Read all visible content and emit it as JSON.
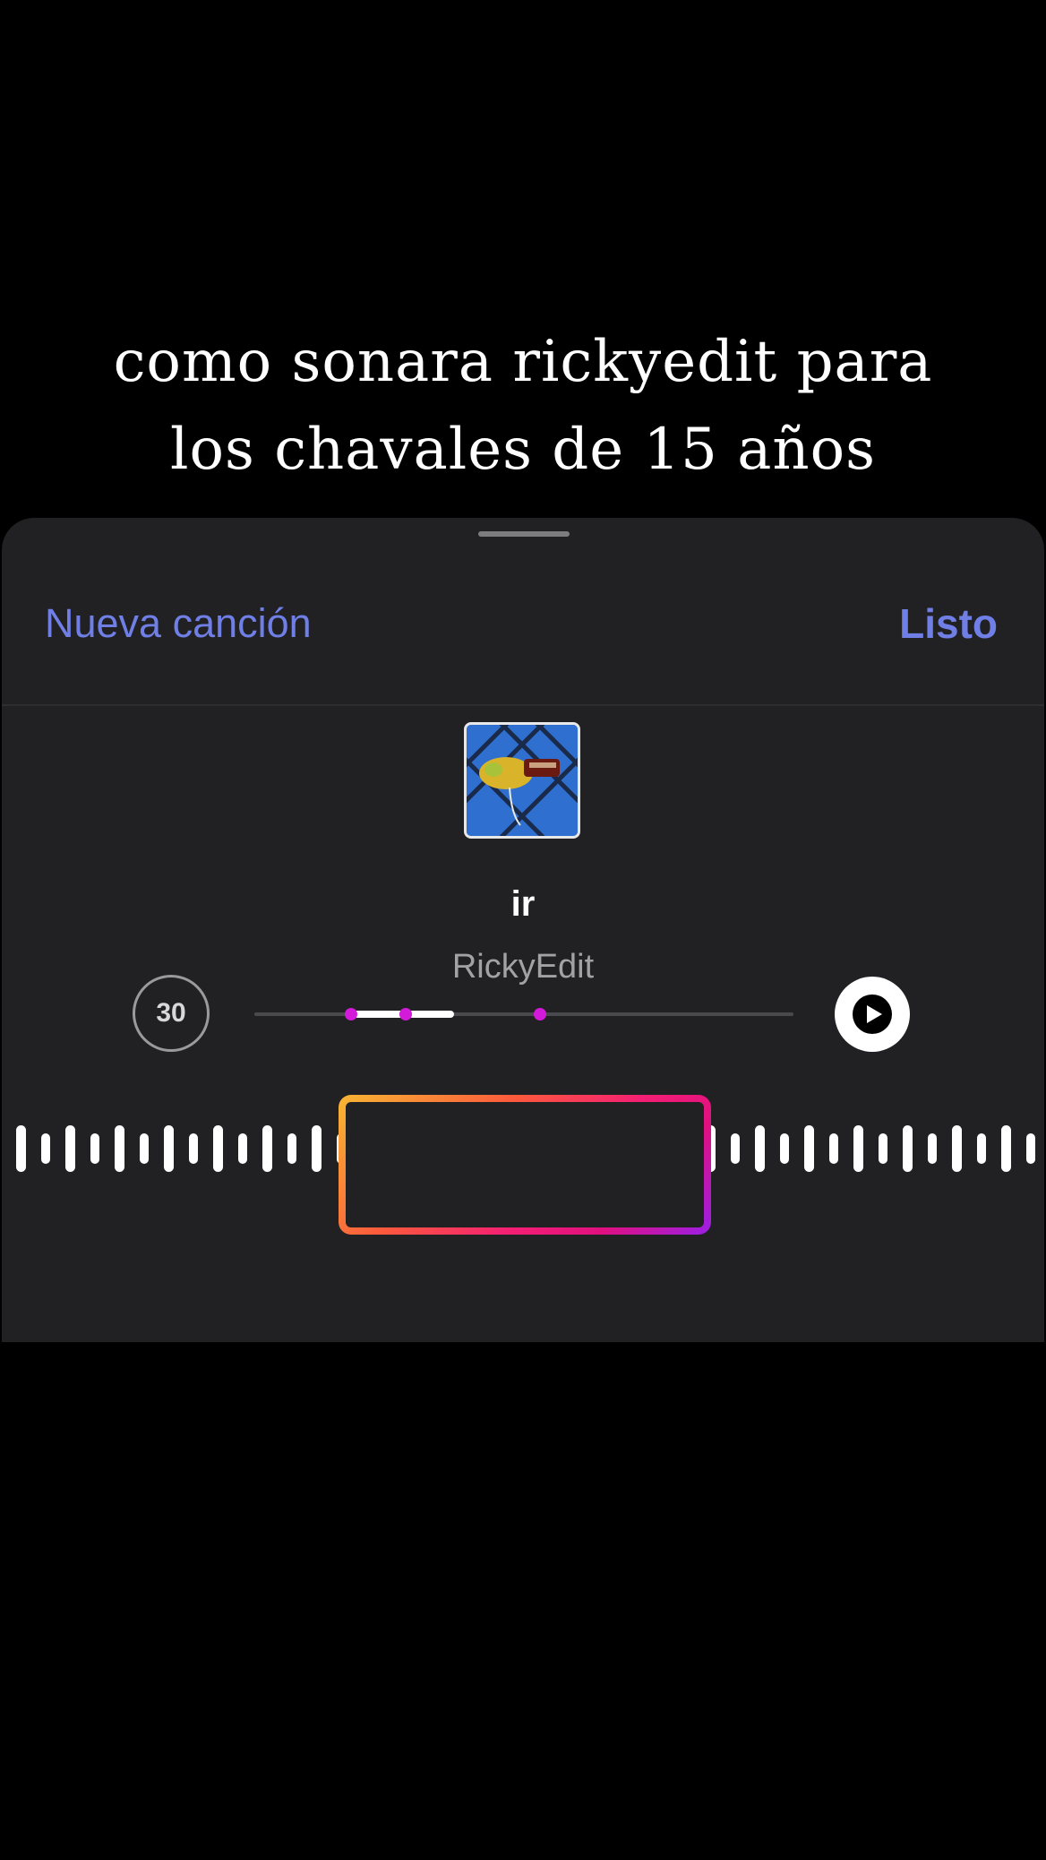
{
  "caption": {
    "line1": "como sonara rickyedit para",
    "line2": "los chavales de 15 años"
  },
  "header": {
    "new_song_label": "Nueva canción",
    "done_label": "Listo"
  },
  "track": {
    "title": "ir",
    "artist": "RickyEdit",
    "clip_duration": "30",
    "selection_start_fraction": 0.18,
    "selection_end_fraction": 0.37,
    "markers_fractions": [
      0.18,
      0.28,
      0.53
    ]
  },
  "colors": {
    "accent": "#6f7fe6",
    "sheet_background": "#212123",
    "marker": "#d21ad8",
    "selection_gradient": [
      "#f7b733",
      "#fc5a3c",
      "#f41f74",
      "#9a1fe8"
    ]
  },
  "icons": {
    "play": "play-icon",
    "grabber": "sheet-grabber"
  }
}
